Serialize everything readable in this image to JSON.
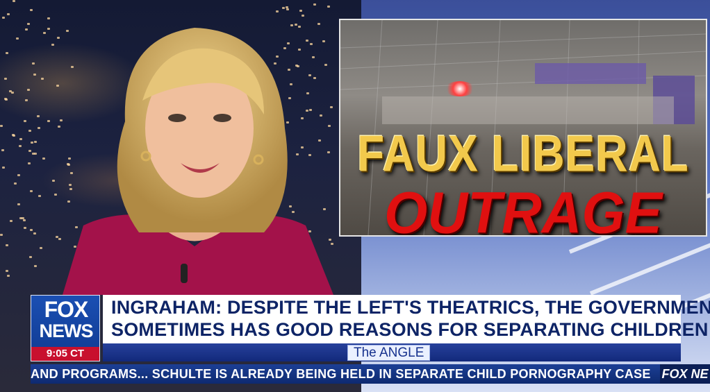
{
  "graphic": {
    "line1": "FAUX LIBERAL",
    "line2": "OUTRAGE"
  },
  "lower_third": {
    "logo_top": "FOX",
    "logo_bottom": "NEWS",
    "time": "9:05 CT",
    "headline": "INGRAHAM: DESPITE THE LEFT'S THEATRICS, THE GOVERNMENT\nSOMETIMES HAS GOOD REASONS FOR SEPARATING CHILDREN",
    "show_tag": "The ANGLE"
  },
  "ticker": {
    "text": "AND PROGRAMS...   SCHULTE IS ALREADY BEING HELD IN SEPARATE CHILD PORNOGRAPHY CASE",
    "logo": "FOX NE"
  },
  "colors": {
    "fox_blue": "#1b4fb3",
    "headline_text": "#0e2466",
    "time_red": "#c8102e",
    "gold": "#f2c94c",
    "outrage_red": "#e01010"
  }
}
